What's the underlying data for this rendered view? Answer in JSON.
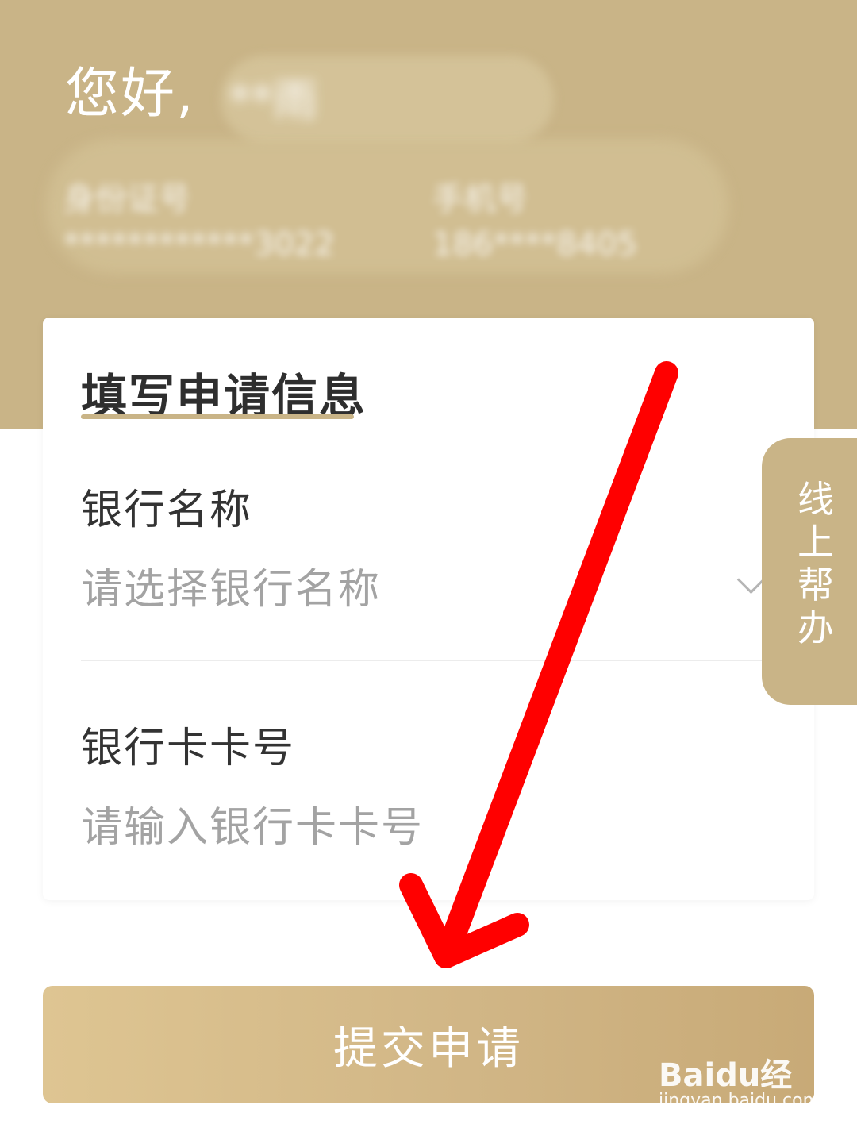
{
  "header": {
    "greeting": "您好,",
    "blurred_name": "**雨",
    "blurred_id_label": "身份证号",
    "blurred_id_value": "************3022",
    "blurred_phone_label": "手机号",
    "blurred_phone_value": "186****8405"
  },
  "form": {
    "title": "填写申请信息",
    "bank_name_label": "银行名称",
    "bank_name_placeholder": "请选择银行名称",
    "card_number_label": "银行卡卡号",
    "card_number_placeholder": "请输入银行卡卡号"
  },
  "side_tab": {
    "label": "线上帮办"
  },
  "submit": {
    "label": "提交申请"
  },
  "watermark": {
    "logo": "Baidu经验",
    "url": "jingyan.baidu.com"
  },
  "colors": {
    "brand_gold": "#c9b487",
    "annotation_arrow": "#ff0000"
  }
}
